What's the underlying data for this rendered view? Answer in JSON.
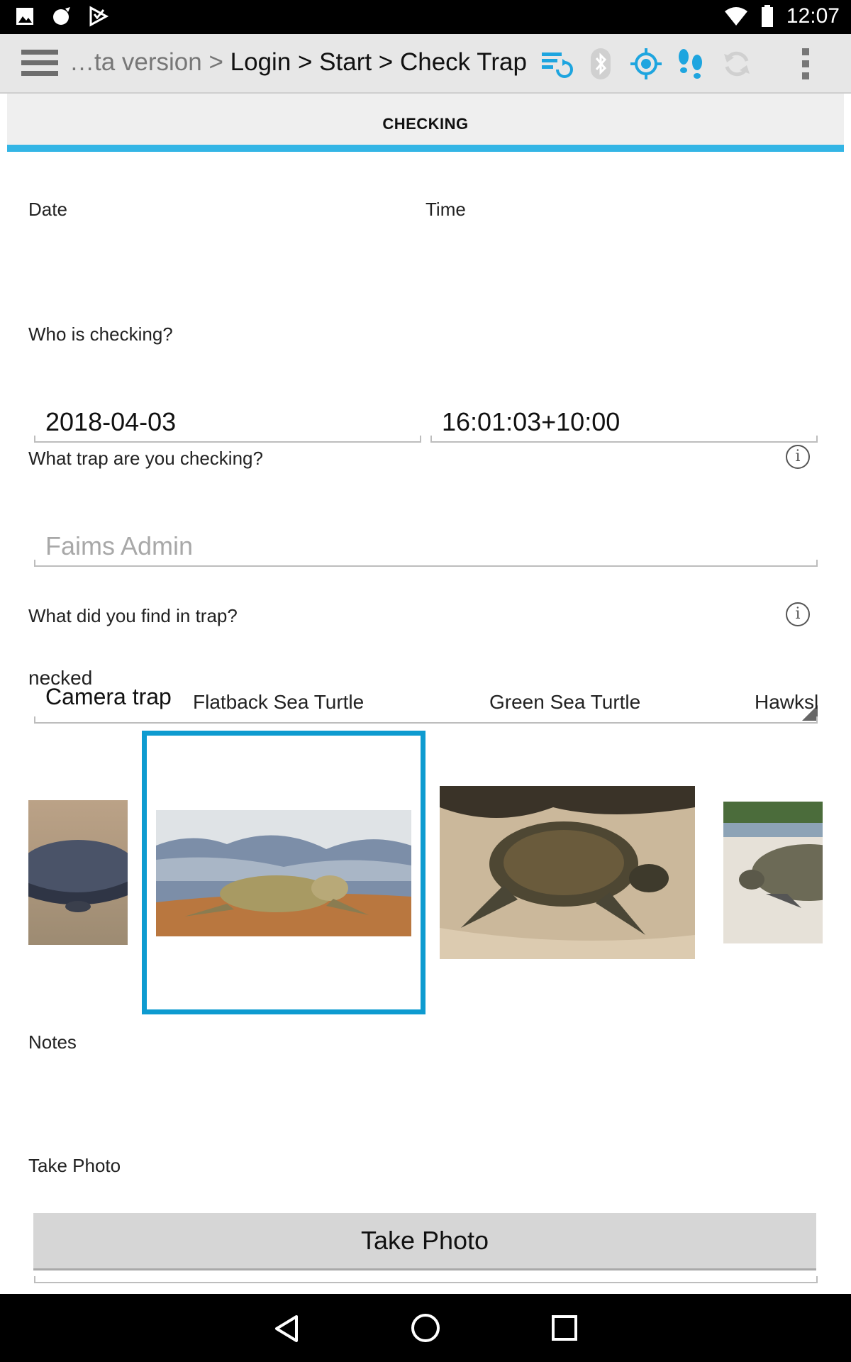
{
  "status_bar": {
    "time": "12:07"
  },
  "app_bar": {
    "breadcrumb_dim": "…ta version >",
    "breadcrumb": "Login > Start > Check Trap"
  },
  "tab": {
    "label": "CHECKING"
  },
  "form": {
    "date_label": "Date",
    "date_value": "2018-04-03",
    "time_label": "Time",
    "time_value": "16:01:03+10:00",
    "who_label": "Who is checking?",
    "who_placeholder": "Faims Admin",
    "trap_label": "What trap are you checking?",
    "trap_value": "Camera trap",
    "find_label": "What did you find in trap?",
    "pictures": [
      {
        "label": "necked",
        "selected": false
      },
      {
        "label": "Flatback Sea Turtle",
        "selected": true
      },
      {
        "label": "Green Sea Turtle",
        "selected": false
      },
      {
        "label": "Hawksl",
        "selected": false
      }
    ],
    "notes_label": "Notes",
    "notes_value": "",
    "photo_label": "Take Photo",
    "photo_button": "Take Photo"
  },
  "colors": {
    "accent": "#33b5e5",
    "selection": "#0e9bd0",
    "icon_blue": "#1ea5df"
  },
  "icons": [
    "menu-icon",
    "sync-icon",
    "bluetooth-icon",
    "gps-icon",
    "footsteps-icon",
    "refresh-icon",
    "overflow-menu-icon",
    "info-icon",
    "back-icon",
    "home-icon",
    "recents-icon"
  ]
}
